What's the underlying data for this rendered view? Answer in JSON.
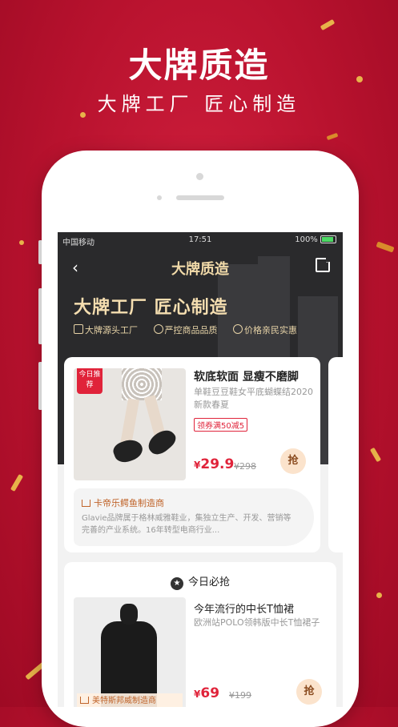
{
  "hero": {
    "title": "大牌质造",
    "subtitle": "大牌工厂 匠心制造"
  },
  "status_bar": {
    "carrier": "中国移动",
    "time": "17:51",
    "battery": "100%"
  },
  "nav": {
    "back_icon": "back-arrow-icon",
    "title": "大牌质造",
    "share_icon": "share-icon"
  },
  "banner": {
    "title": "大牌工厂 匠心制造",
    "features": [
      {
        "icon": "home-icon",
        "label": "大牌源头工厂"
      },
      {
        "icon": "heart-shield-icon",
        "label": "严控商品品质"
      },
      {
        "icon": "yen-icon",
        "label": "价格亲民实惠"
      }
    ]
  },
  "product1": {
    "badge": "今日推荐",
    "title": "软底软面 显瘦不磨脚",
    "description": "单鞋豆豆鞋女平底蝴蝶结2020新款春夏",
    "coupon": "领券满50减5",
    "currency": "¥",
    "price": "29.9",
    "original_price": "¥298",
    "grab_label": "抢",
    "brand_name": "卡帝乐鳄鱼制造商",
    "brand_desc": "Glavie品牌属于格林威雅鞋业，集独立生产、开发、营销等完善的产业系统。16年转型电商行业..."
  },
  "section": {
    "icon": "star-icon",
    "title": "今日必抢"
  },
  "product2": {
    "title": "今年流行的中长T恤裙",
    "description": "欧洲站POLO领韩版中长T恤裙子",
    "brand_name": "美特斯邦威制造商",
    "currency": "¥",
    "price": "69",
    "original_price": "¥199",
    "grab_label": "抢"
  },
  "colors": {
    "background_red": "#b8122e",
    "accent_red": "#e0233a",
    "gold_text": "#f0d9a8",
    "header_dark": "#2a2a2c"
  }
}
